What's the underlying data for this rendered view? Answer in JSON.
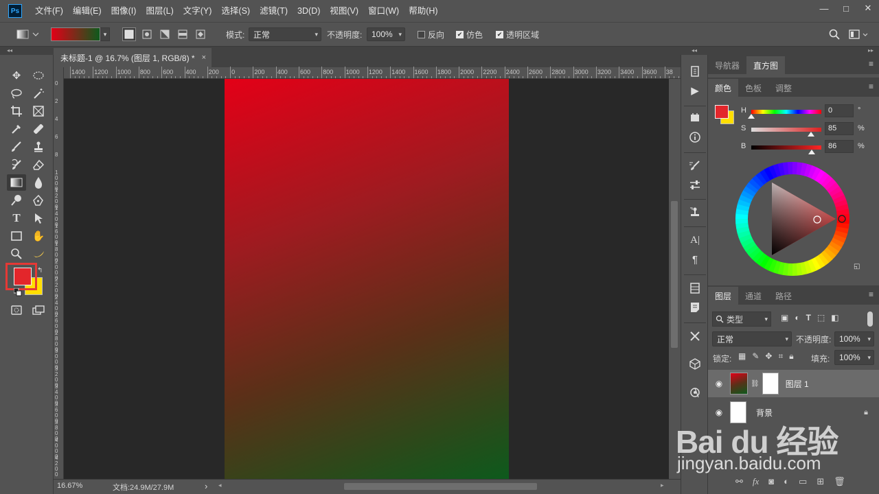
{
  "app": {
    "logo": "Ps"
  },
  "menu": [
    "文件(F)",
    "编辑(E)",
    "图像(I)",
    "图层(L)",
    "文字(Y)",
    "选择(S)",
    "滤镜(T)",
    "3D(D)",
    "视图(V)",
    "窗口(W)",
    "帮助(H)"
  ],
  "window_controls": {
    "minimize": "—",
    "maximize": "□",
    "close": "✕"
  },
  "options": {
    "mode_label": "模式:",
    "mode_value": "正常",
    "opacity_label": "不透明度:",
    "opacity_value": "100%",
    "reverse_label": "反向",
    "dither_label": "仿色",
    "transparency_label": "透明区域",
    "reverse_checked": false,
    "dither_checked": true,
    "transparency_checked": true
  },
  "document": {
    "tab_title": "未标题-1 @ 16.7% (图层 1, RGB/8) *",
    "close": "×"
  },
  "ruler_h": [
    "1400",
    "1200",
    "1000",
    "800",
    "600",
    "400",
    "200",
    "0",
    "200",
    "400",
    "600",
    "800",
    "1000",
    "1200",
    "1400",
    "1600",
    "1800",
    "2000",
    "2200",
    "2400",
    "2600",
    "2800",
    "3000",
    "3200",
    "3400",
    "3600",
    "38"
  ],
  "ruler_v": [
    "0",
    "2",
    "4",
    "6",
    "8",
    "1000",
    "1200",
    "1400",
    "1600",
    "1800",
    "2000",
    "2200",
    "2400",
    "2600",
    "2800",
    "3000",
    "3200",
    "3400",
    "3600",
    "3800",
    "4000",
    "4200",
    "4400"
  ],
  "status": {
    "zoom": "16.67%",
    "doc_size": "文档:24.9M/27.9M",
    "arrow": "›"
  },
  "colors": {
    "foreground": "#e3262b",
    "background": "#ffde00",
    "highlight": "#e53935",
    "gradient_start": "#e30017",
    "gradient_end": "#0d5a1c"
  },
  "right_top_tabs": [
    "导航器",
    "直方图"
  ],
  "right_top_active": 1,
  "color_tabs": [
    "颜色",
    "色板",
    "调整"
  ],
  "color_active": 0,
  "hsb": [
    {
      "label": "H",
      "value": "0",
      "unit": "°",
      "level": 0.0
    },
    {
      "label": "S",
      "value": "85",
      "unit": "%",
      "level": 0.85
    },
    {
      "label": "B",
      "value": "86",
      "unit": "%",
      "level": 0.86
    }
  ],
  "layers_tabs": [
    "图层",
    "通道",
    "路径"
  ],
  "layers_active": 0,
  "layers": {
    "filter_label": "类型",
    "blend_mode": "正常",
    "opacity_label": "不透明度:",
    "opacity_value": "100%",
    "lock_label": "锁定:",
    "fill_label": "填充:",
    "fill_value": "100%",
    "items": [
      {
        "name": "图层 1",
        "selected": true
      },
      {
        "name": "背景",
        "selected": false
      }
    ]
  },
  "watermark": {
    "logo": "Bai du 经验",
    "url": "jingyan.baidu.com"
  }
}
